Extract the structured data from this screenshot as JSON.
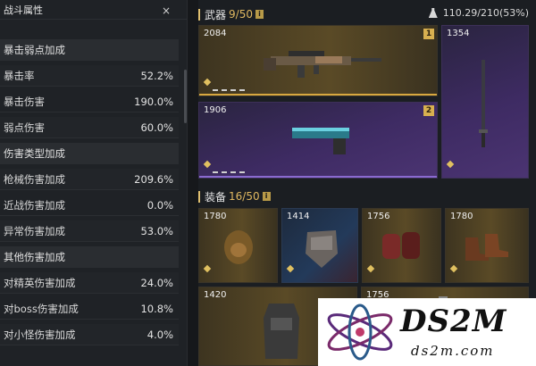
{
  "stats_panel": {
    "title": "战斗属性",
    "close_label": "×",
    "rows": [
      {
        "type": "section",
        "label": "暴击弱点加成",
        "value": ""
      },
      {
        "type": "item",
        "label": "暴击率",
        "value": "52.2%"
      },
      {
        "type": "item",
        "label": "暴击伤害",
        "value": "190.0%"
      },
      {
        "type": "item",
        "label": "弱点伤害",
        "value": "60.0%"
      },
      {
        "type": "section",
        "label": "伤害类型加成",
        "value": ""
      },
      {
        "type": "item",
        "label": "枪械伤害加成",
        "value": "209.6%"
      },
      {
        "type": "item",
        "label": "近战伤害加成",
        "value": "0.0%"
      },
      {
        "type": "item",
        "label": "异常伤害加成",
        "value": "53.0%"
      },
      {
        "type": "section",
        "label": "其他伤害加成",
        "value": ""
      },
      {
        "type": "item",
        "label": "对精英伤害加成",
        "value": "24.0%"
      },
      {
        "type": "item",
        "label": "对boss伤害加成",
        "value": "10.8%"
      },
      {
        "type": "item",
        "label": "对小怪伤害加成",
        "value": "4.0%"
      }
    ]
  },
  "weapons": {
    "title": "武器",
    "count": "9/50",
    "info_icon": "i",
    "weight": "110.29/210(53%)",
    "cards": [
      {
        "power": "2084",
        "slot": "1",
        "icon": "rifle-icon"
      },
      {
        "power": "1354",
        "slot": "",
        "icon": "sword-icon"
      },
      {
        "power": "1906",
        "slot": "2",
        "icon": "pistol-icon"
      }
    ]
  },
  "gear": {
    "title": "装备",
    "count": "16/50",
    "info_icon": "i",
    "cards": [
      {
        "power": "1780",
        "icon": "helmet-icon"
      },
      {
        "power": "1414",
        "icon": "mask-icon"
      },
      {
        "power": "1756",
        "icon": "gloves-icon"
      },
      {
        "power": "1780",
        "icon": "boots-icon"
      },
      {
        "power": "1420",
        "icon": "vest-icon"
      },
      {
        "power": "1756",
        "icon": "bag-icon"
      }
    ]
  },
  "watermark": {
    "brand": "DS2M",
    "domain": "ds2m.com"
  }
}
